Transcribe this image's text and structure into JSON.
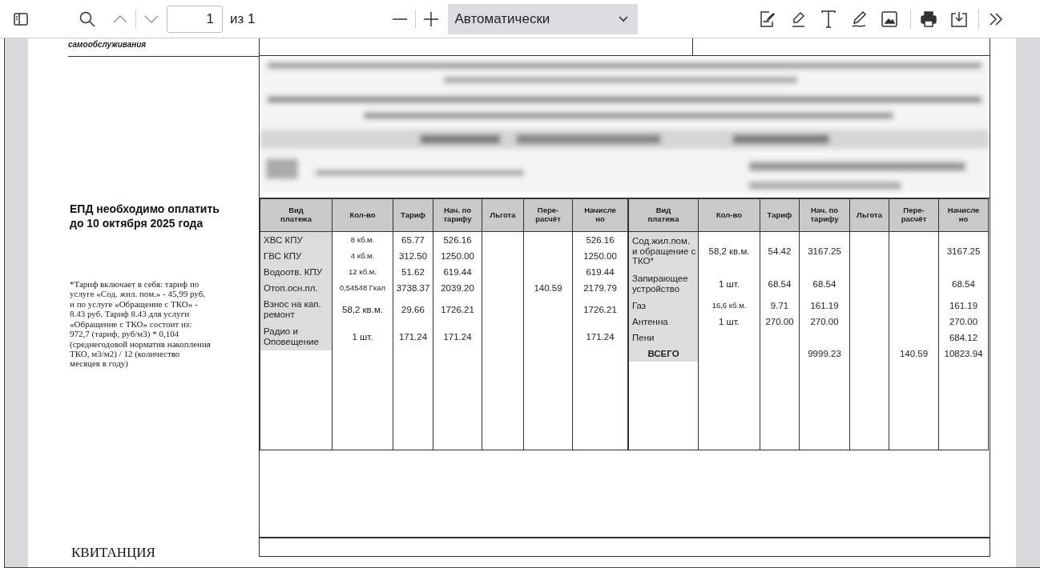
{
  "toolbar": {
    "page_number": "1",
    "page_count": "из 1",
    "zoom": "Автоматически"
  },
  "document": {
    "header_fragment": "самообслуживания",
    "deadline": "ЕПД необходимо оплатить\nдо 10 октября 2025 года",
    "note": "*Тариф включает в себя: тариф по\nуслуге «Сод. жил. пом.» - 45,99 руб.\nи по услуге «Обращение с ТКО» -\n8.43 руб. Тариф  8.43 для услуги\n«Обращение с ТКО» состоит из:\n972,7 (тариф, руб/м3) * 0,104\n(среднегодовой норматив накопления\nТКО, м3/м2) / 12 (количество\nмесяцев в году)",
    "footer_title": "КВИТАНЦИЯ",
    "charges": [
      {
        "columns": [
          "Вид\nплатежа",
          "Кол-во",
          "Тариф",
          "Нач. по\nтарифу",
          "Льгота",
          "Пере-\nрасчёт",
          "Начисле\nно"
        ],
        "rows": [
          {
            "kind": "item",
            "name": "ХВС КПУ",
            "quantity": "8 кб.м.",
            "tariff": "65.77",
            "charged": "526.16",
            "total": "526.16"
          },
          {
            "kind": "item",
            "name": "ГВС КПУ",
            "quantity": "4 кб.м.",
            "tariff": "312.50",
            "charged": "1250.00",
            "total": "1250.00"
          },
          {
            "kind": "item",
            "name": "Водоотв. КПУ",
            "quantity": "12 кб.м.",
            "tariff": "51.62",
            "charged": "619.44",
            "total": "619.44"
          },
          {
            "kind": "item",
            "name": "Отоп.осн.пл.",
            "quantity": "0,54548 Гкал",
            "tariff": "3738.37",
            "charged": "2039.20",
            "recalc": "140.59",
            "total": "2179.79"
          },
          {
            "kind": "item",
            "name": "Взнос на кап. ремонт",
            "quantity": "58,2 кв.м.",
            "tariff": "29.66",
            "charged": "1726.21",
            "total": "1726.21"
          },
          {
            "kind": "item",
            "name": "Радио и Оповещение",
            "quantity": "1 шт.",
            "tariff": "171.24",
            "charged": "171.24",
            "total": "171.24"
          }
        ]
      },
      {
        "columns": [
          "Вид\nплатежа",
          "Кол-во",
          "Тариф",
          "Нач. по\nтарифу",
          "Льгота",
          "Пере-\nрасчёт",
          "Начисле\nно"
        ],
        "rows": [
          {
            "kind": "item",
            "name": "Сод.жил.пом. и обращение с ТКО*",
            "quantity": "58,2 кв.м.",
            "tariff": "54.42",
            "charged": "3167.25",
            "total": "3167.25"
          },
          {
            "kind": "item",
            "name": "Запирающее устройство",
            "quantity": "1 шт.",
            "tariff": "68.54",
            "charged": "68.54",
            "total": "68.54"
          },
          {
            "kind": "item",
            "name": "Газ",
            "quantity": "16,6 кб.м.",
            "tariff": "9.71",
            "charged": "161.19",
            "total": "161.19"
          },
          {
            "kind": "item",
            "name": "Антенна",
            "quantity": "1 шт.",
            "tariff": "270.00",
            "charged": "270.00",
            "total": "270.00"
          },
          {
            "kind": "item",
            "name": "Пени",
            "total": "684.12"
          },
          {
            "kind": "total",
            "name": "ВСЕГО",
            "charged": "9999.23",
            "recalc": "140.59",
            "total": "10823.94"
          }
        ]
      }
    ]
  }
}
